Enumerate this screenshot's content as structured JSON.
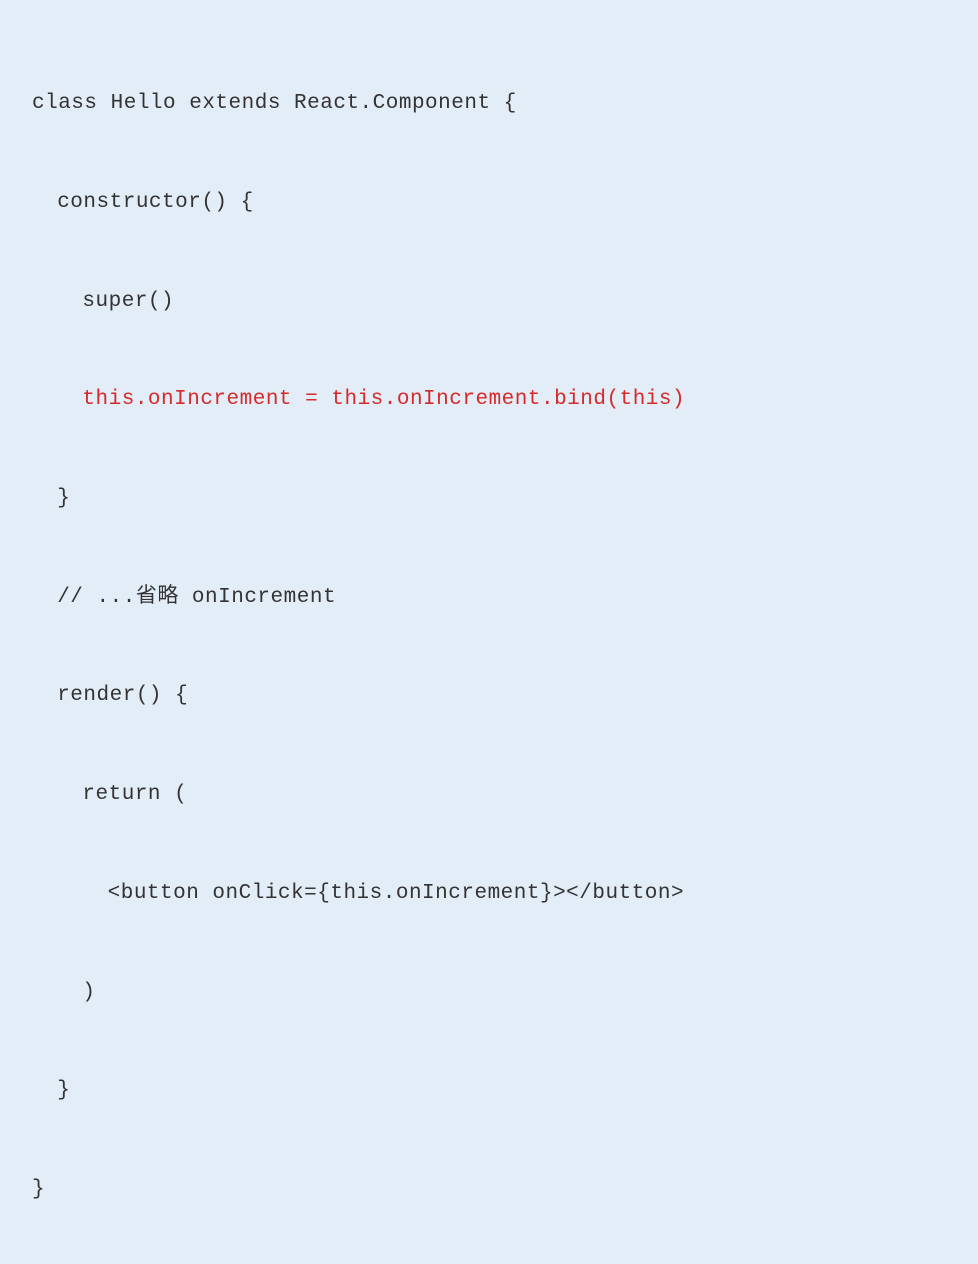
{
  "code": {
    "line1": "class Hello extends React.Component {",
    "line2": "constructor() {",
    "line3": "super()",
    "line4": "this.onIncrement = this.onIncrement.bind(this)",
    "line5": "}",
    "line6": "// ...省略 onIncrement",
    "line7": "render() {",
    "line8": "return (",
    "line9": "<button onClick={this.onIncrement}></button>",
    "line10": ")",
    "line11": "}",
    "line12": "}"
  }
}
